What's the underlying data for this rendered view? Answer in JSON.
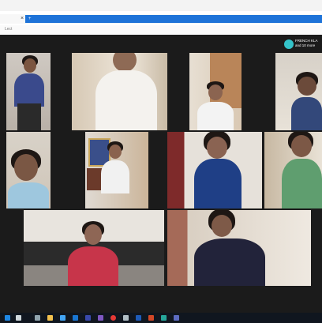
{
  "browser": {
    "tab_close": "×",
    "address": "+",
    "page_hint": "Lect"
  },
  "meeting": {
    "host_name_line1": "FRENCH KLA",
    "host_name_line2": "and 10 more"
  },
  "colors": {
    "address_bar": "#1e73d8",
    "meeting_bg": "#1b1b1b",
    "taskbar": "#10161f"
  },
  "taskbar": {
    "icons": [
      "windows-icon",
      "search-icon",
      "task-view-icon",
      "file-explorer-icon",
      "store-icon",
      "mail-icon",
      "calendar-icon",
      "photos-icon",
      "chrome-icon",
      "settings-icon",
      "word-icon",
      "powerpoint-icon",
      "edge-icon",
      "teams-icon"
    ]
  }
}
